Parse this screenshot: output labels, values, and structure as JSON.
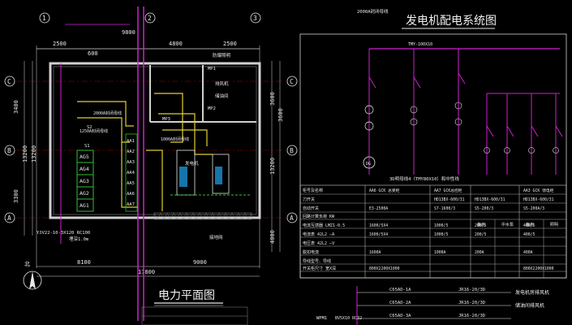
{
  "titles": {
    "system": "发电机配电系统图",
    "plan": "电力平面图"
  },
  "plan": {
    "dims_top": [
      "2500",
      "4800",
      "2500",
      "9800",
      "600"
    ],
    "dims_bottom": [
      "8100",
      "9000",
      "17800"
    ],
    "dims_left": [
      "3400",
      "13200",
      "13200",
      "3300"
    ],
    "dims_right": [
      "3600",
      "3600",
      "13200",
      "4000"
    ],
    "axis_letters": [
      "C",
      "B",
      "A",
      "C",
      "B",
      "A"
    ],
    "axis_numbers": [
      "1",
      "2",
      "3",
      "1",
      "2",
      "3"
    ],
    "panels_left": [
      "AG5",
      "AG4",
      "AG3",
      "AG2",
      "AG1"
    ],
    "panels_aa": [
      "AA1",
      "AA2",
      "AA3",
      "AA4",
      "AA5",
      "AA6",
      "AA7"
    ],
    "notes": [
      "YJV22-10-3X120 RC100",
      "埋深1.0m",
      "2000A封闭母线",
      "1250A封闭母线",
      "1000A封闭母线",
      "接地网",
      "防爆照明",
      "储油间",
      "排风机",
      "S2",
      "S1",
      "MP1",
      "MP2",
      "MP3",
      "发电机",
      "4800",
      "5600"
    ],
    "compass": "北"
  },
  "system": {
    "header_note": "2000A封闭母线",
    "bus_label": "TMY-100X10",
    "generator_label": "DG",
    "busbar_caption": "3D明母线4（TMY80X10）和中性线",
    "table_rows": [
      {
        "name": "柜号及名称",
        "cols": [
          "AA6 GCK 总受柜",
          "AA7 GCK总控柜",
          "",
          "AA3 GCK 馈电柜"
        ]
      },
      {
        "name": "刀开关",
        "cols": [
          "",
          "HD13BX-600/31",
          "HD13BX-600/31",
          "HD13BX-600/31"
        ]
      },
      {
        "name": "自动开关",
        "cols": [
          "E3-2500A",
          "S7-1600/3",
          "S5-200/3",
          "S5-200A/3"
        ]
      },
      {
        "name": "回路计算负荷 KW",
        "cols": [
          "",
          "",
          "",
          ""
        ]
      },
      {
        "name": "电流互感器 LMZ1-0.5",
        "cols": [
          "1600/5X4",
          "1000/5",
          "200/5",
          "400/5"
        ]
      },
      {
        "name": "电流表 42L2 —A",
        "cols": [
          "1600/5X4",
          "1000/5",
          "200/5",
          "400/5"
        ]
      },
      {
        "name": "电压表 42L2 —V",
        "cols": [
          "",
          "",
          "",
          ""
        ]
      },
      {
        "name": "脱扣电流",
        "cols": [
          "1600A",
          "1000A",
          "200A",
          "400A"
        ]
      },
      {
        "name": "导线型号、导线",
        "cols": [
          "",
          "",
          "",
          ""
        ]
      },
      {
        "name": "开关柜尺寸 宽X深",
        "cols": [
          "800X2200X1000",
          "",
          "",
          "800X2200X1000"
        ]
      }
    ],
    "sub_headers": [
      "备用",
      "中水泵",
      "备用",
      "照明"
    ],
    "bottom_codes": [
      "C65AD-1A",
      "C65AD-2A",
      "C65AD-3A",
      "C65AD-4A"
    ],
    "bottom_wires": [
      "JR16-20/3D",
      "JR16-20/3D",
      "JR16-20/3D"
    ],
    "bottom_labels": [
      "发电机房排风机",
      "储油间排风机"
    ],
    "bottom_misc": [
      "WPM1",
      "BV5X10 RC32",
      "C65N-16A/1",
      "WL1",
      "备用"
    ]
  }
}
